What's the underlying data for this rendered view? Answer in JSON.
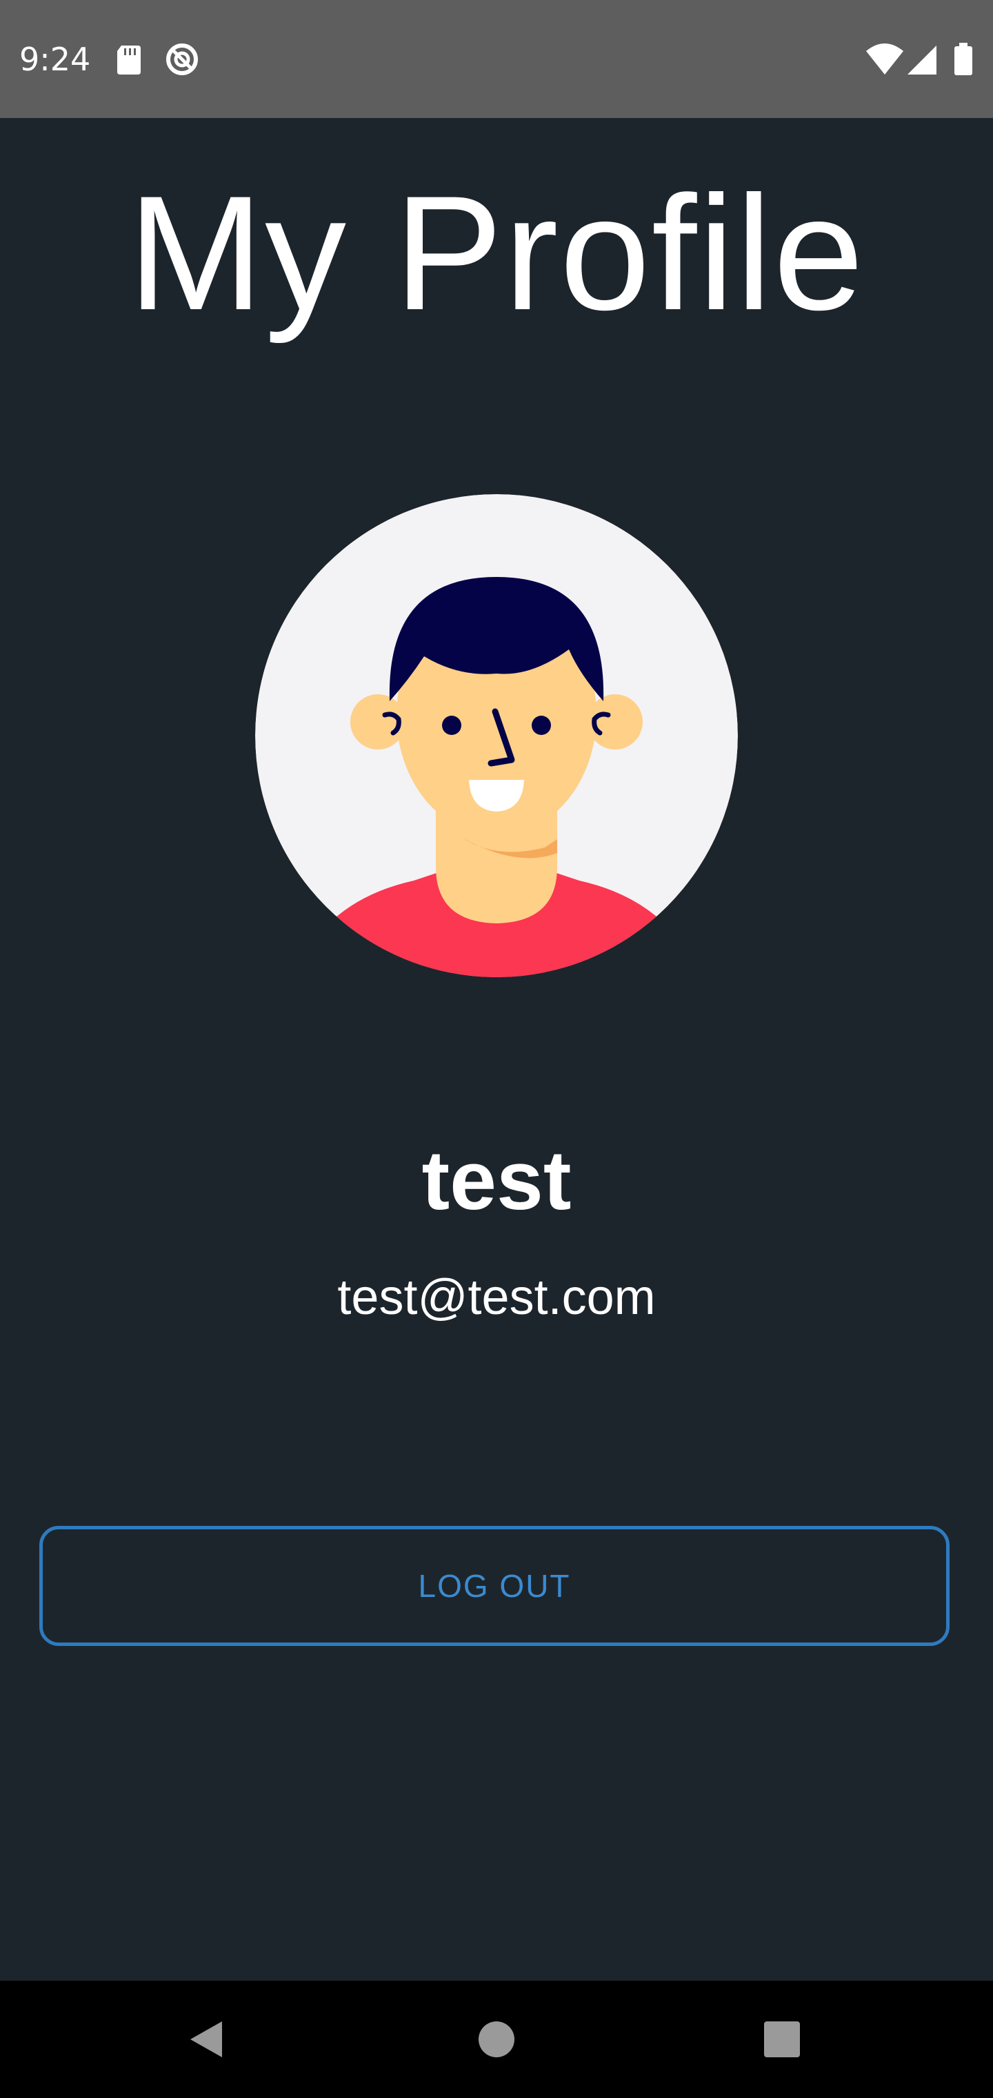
{
  "status_bar": {
    "time": "9:24",
    "left_icons": [
      "sd-card-icon",
      "data-saver-icon"
    ],
    "right_icons": [
      "wifi-icon",
      "cell-signal-icon",
      "battery-icon"
    ]
  },
  "page": {
    "title": "My Profile"
  },
  "profile": {
    "avatar_icon": "avatar-illustration",
    "name": "test",
    "email": "test@test.com"
  },
  "actions": {
    "logout_label": "LOG OUT"
  },
  "nav_bar": {
    "buttons": [
      "back-icon",
      "home-icon",
      "recents-icon"
    ]
  },
  "colors": {
    "background": "#1d252c",
    "status_bar": "#5e5e5e",
    "accent": "#2e7bbf",
    "text": "#ffffff",
    "avatar_bg": "#f3f2f5",
    "shirt": "#fb3751",
    "skin": "#fed088",
    "hair": "#040348"
  }
}
